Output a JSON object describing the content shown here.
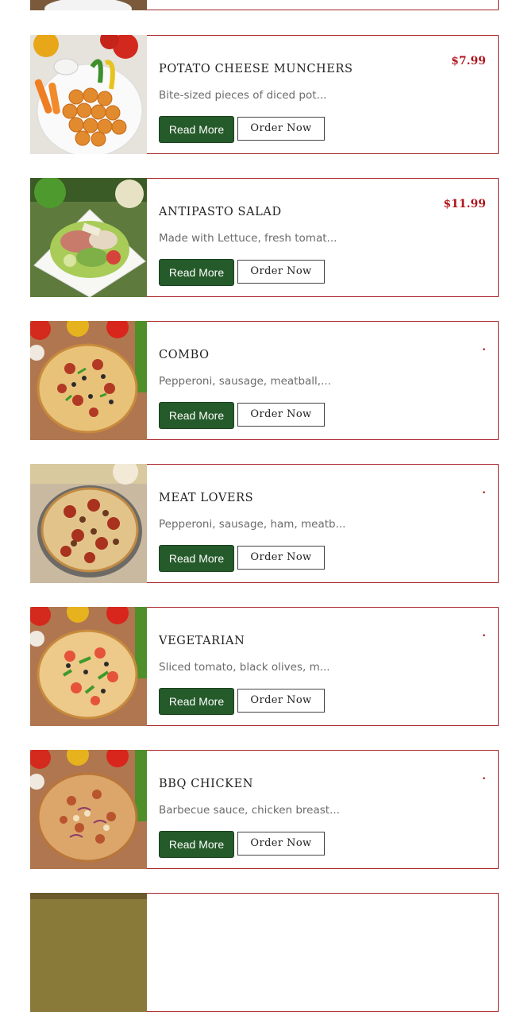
{
  "buttons": {
    "read_more": "Read More",
    "order_now": "Order Now"
  },
  "colors": {
    "accent": "#a8242a",
    "price": "#b0161e",
    "button_green": "#255a2a",
    "desc": "#6b6b6b"
  },
  "menu": {
    "items": [
      {
        "title": "POTATO CHEESE MUNCHERS",
        "price": "$7.99",
        "description": "Bite-sized pieces of diced pot...",
        "image_icon": "potato-munchers-photo"
      },
      {
        "title": "ANTIPASTO SALAD",
        "price": "$11.99",
        "description": "Made with Lettuce, fresh tomat...",
        "image_icon": "salad-photo"
      },
      {
        "title": "COMBO",
        "price": ".",
        "description": "Pepperoni, sausage, meatball,...",
        "image_icon": "pizza-photo"
      },
      {
        "title": "MEAT LOVERS",
        "price": ".",
        "description": "Pepperoni, sausage, ham, meatb...",
        "image_icon": "pizza-photo"
      },
      {
        "title": "VEGETARIAN",
        "price": ".",
        "description": "Sliced tomato, black olives, m...",
        "image_icon": "pizza-photo"
      },
      {
        "title": "BBQ CHICKEN",
        "price": ".",
        "description": "Barbecue sauce, chicken breast...",
        "image_icon": "pizza-photo"
      }
    ]
  }
}
